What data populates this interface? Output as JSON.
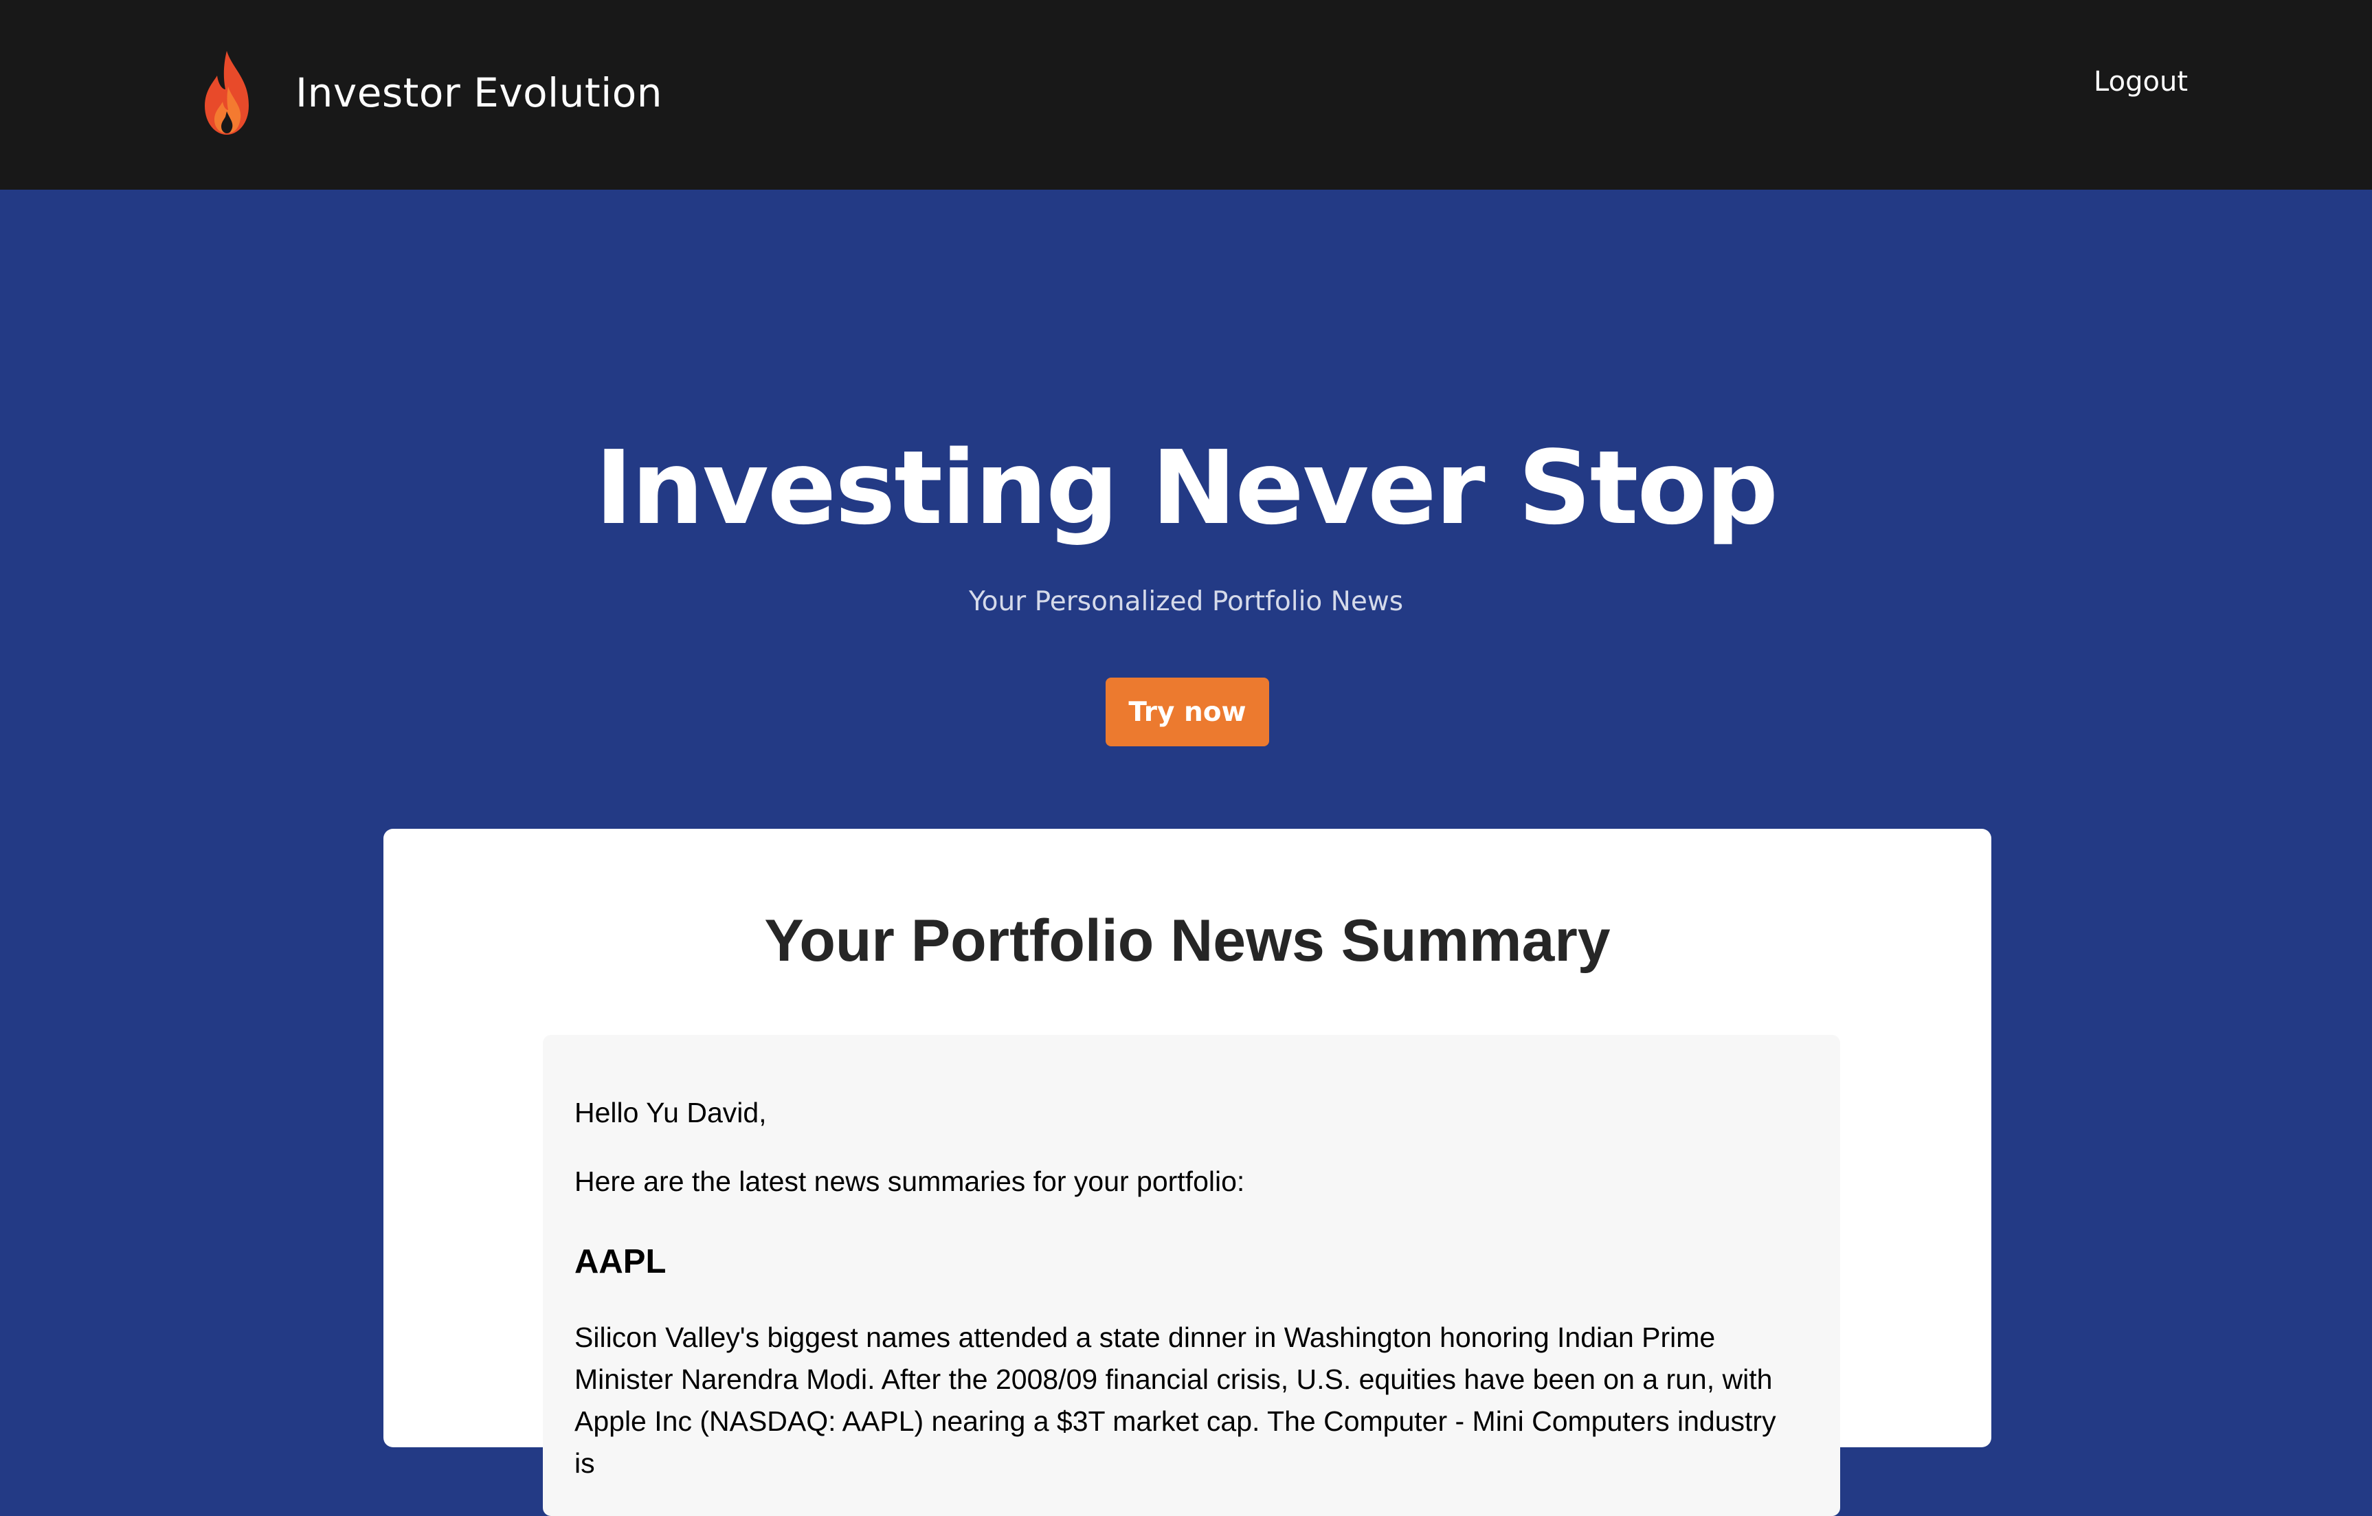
{
  "header": {
    "brand_name": "Investor Evolution",
    "logo_icon": "flame-icon",
    "logout_label": "Logout"
  },
  "hero": {
    "title": "Investing Never Stop",
    "subtitle": "Your Personalized Portfolio News",
    "cta_label": "Try now"
  },
  "summary_card": {
    "title": "Your Portfolio News Summary",
    "greeting": "Hello Yu David,",
    "intro": "Here are the latest news summaries for your portfolio:",
    "items": [
      {
        "ticker": "AAPL",
        "summary": "Silicon Valley's biggest names attended a state dinner in Washington honoring Indian Prime Minister Narendra Modi. After the 2008/09 financial crisis, U.S. equities have been on a run, with Apple Inc (NASDAQ: AAPL) nearing a $3T market cap. The Computer - Mini Computers industry is"
      }
    ]
  },
  "colors": {
    "navbar_bg": "#181818",
    "hero_bg": "#233a85",
    "accent": "#ec7a2f",
    "card_bg": "#ffffff",
    "news_box_bg": "#f7f7f7"
  }
}
